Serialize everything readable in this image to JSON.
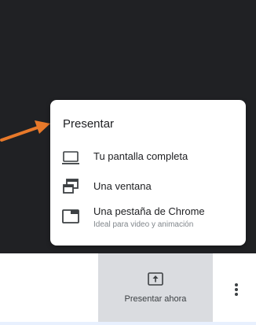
{
  "colors": {
    "video_background": "#202124",
    "arrow": "#e8792a",
    "menu_background": "#ffffff",
    "button_active": "#dadce0",
    "secondary_text": "#80868b"
  },
  "menu": {
    "title": "Presentar",
    "items": [
      {
        "icon": "monitor-icon",
        "label": "Tu pantalla completa"
      },
      {
        "icon": "window-icon",
        "label": "Una ventana"
      },
      {
        "icon": "tab-icon",
        "label": "Una pestaña de Chrome",
        "sublabel": "Ideal para video y animación"
      }
    ]
  },
  "toolbar": {
    "present_label": "Presentar ahora",
    "present_icon": "present-screen-icon",
    "more_icon": "more-vert-icon"
  }
}
